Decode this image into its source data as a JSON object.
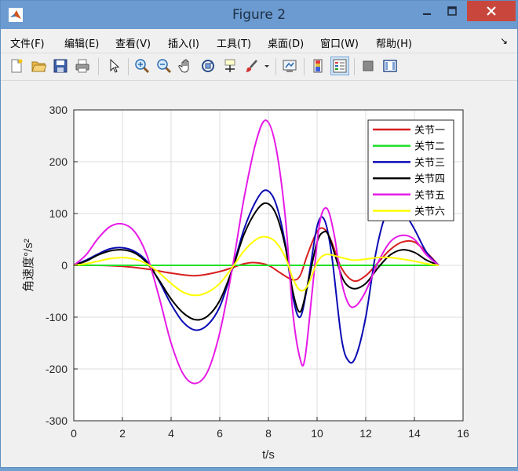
{
  "window": {
    "title": "Figure 2"
  },
  "menu": [
    {
      "label": "文件(F)"
    },
    {
      "label": "编辑(E)"
    },
    {
      "label": "查看(V)"
    },
    {
      "label": "插入(I)"
    },
    {
      "label": "工具(T)"
    },
    {
      "label": "桌面(D)"
    },
    {
      "label": "窗口(W)"
    },
    {
      "label": "帮助(H)"
    }
  ],
  "toolbar_icons": [
    "new-figure-icon",
    "open-file-icon",
    "save-icon",
    "print-icon",
    "pointer-icon",
    "zoom-in-icon",
    "zoom-out-icon",
    "pan-icon",
    "rotate-3d-icon",
    "data-cursor-icon",
    "brush-icon",
    "link-plot-icon",
    "colorbar-icon",
    "legend-icon",
    "hide-plot-tools-icon",
    "show-plot-tools-icon"
  ],
  "colors": {
    "titlebar": "#6b9bd0",
    "close": "#c9463d"
  },
  "chart_data": {
    "type": "line",
    "xlabel": "t/s",
    "ylabel": "角速度°/s²",
    "xlim": [
      0,
      16
    ],
    "ylim": [
      -300,
      300
    ],
    "xticks": [
      0,
      2,
      4,
      6,
      8,
      10,
      12,
      14,
      16
    ],
    "yticks": [
      -300,
      -200,
      -100,
      0,
      100,
      200,
      300
    ],
    "grid": true,
    "legend_position": "top-right",
    "series": [
      {
        "name": "关节一",
        "color": "#d81f1f",
        "x": [
          0,
          1,
          2,
          3,
          4,
          5,
          6,
          7,
          7.5,
          8,
          8.5,
          9,
          9.3,
          9.6,
          10,
          10.3,
          10.6,
          11,
          11.5,
          12,
          12.5,
          13,
          13.5,
          14,
          14.5,
          15
        ],
        "y": [
          0,
          0,
          -2,
          -7,
          -15,
          -20,
          -12,
          3,
          5,
          0,
          -15,
          -28,
          -20,
          20,
          65,
          70,
          45,
          -5,
          -30,
          -20,
          5,
          30,
          45,
          45,
          25,
          0
        ]
      },
      {
        "name": "关节二",
        "color": "#22e02a",
        "x": [
          0,
          1,
          2,
          3,
          4,
          5,
          6,
          7,
          8,
          9,
          10,
          11,
          12,
          13,
          14,
          15
        ],
        "y": [
          0,
          0,
          0,
          0,
          0,
          0,
          0,
          0,
          0,
          0,
          0,
          0,
          0,
          0,
          0,
          0
        ]
      },
      {
        "name": "关节三",
        "color": "#0a0ab4",
        "x": [
          0,
          0.5,
          1,
          1.5,
          2,
          2.5,
          3,
          3.5,
          4,
          4.5,
          5,
          5.5,
          6,
          6.5,
          7,
          7.5,
          7.9,
          8.3,
          8.7,
          9,
          9.3,
          9.6,
          10,
          10.3,
          10.6,
          11,
          11.3,
          11.6,
          12,
          12.4,
          12.8,
          13.2,
          13.6,
          14,
          14.5,
          15
        ],
        "y": [
          0,
          10,
          22,
          32,
          34,
          27,
          8,
          -30,
          -75,
          -110,
          -125,
          -115,
          -80,
          -10,
          70,
          125,
          145,
          120,
          40,
          -60,
          -100,
          -40,
          75,
          88,
          20,
          -140,
          -185,
          -175,
          -100,
          20,
          95,
          115,
          100,
          70,
          25,
          0
        ]
      },
      {
        "name": "关节四",
        "color": "#000000",
        "x": [
          0,
          0.5,
          1,
          1.5,
          2,
          2.5,
          3,
          3.5,
          4,
          4.5,
          5,
          5.5,
          6,
          6.5,
          7,
          7.5,
          7.9,
          8.3,
          8.7,
          9,
          9.3,
          9.6,
          10,
          10.3,
          10.5,
          10.8,
          11.1,
          11.5,
          12,
          12.5,
          13,
          13.5,
          14,
          14.5,
          15
        ],
        "y": [
          0,
          8,
          20,
          28,
          30,
          24,
          5,
          -28,
          -65,
          -92,
          -105,
          -98,
          -68,
          -10,
          60,
          105,
          120,
          100,
          35,
          -50,
          -90,
          -40,
          45,
          65,
          55,
          10,
          -30,
          -45,
          -35,
          -5,
          20,
          30,
          25,
          10,
          0
        ]
      },
      {
        "name": "关节五",
        "color": "#e61ae6",
        "x": [
          0,
          0.5,
          1,
          1.5,
          2,
          2.5,
          3,
          3.5,
          4,
          4.5,
          5,
          5.5,
          6,
          6.5,
          7,
          7.5,
          7.9,
          8.3,
          8.7,
          9,
          9.3,
          9.5,
          9.8,
          10.1,
          10.4,
          10.7,
          11,
          11.3,
          11.6,
          12,
          12.5,
          13,
          13.5,
          14,
          14.5,
          15
        ],
        "y": [
          0,
          20,
          52,
          75,
          80,
          65,
          20,
          -60,
          -150,
          -210,
          -228,
          -205,
          -130,
          -10,
          130,
          240,
          280,
          230,
          90,
          -90,
          -180,
          -180,
          -50,
          80,
          110,
          60,
          -30,
          -75,
          -78,
          -50,
          5,
          45,
          58,
          50,
          20,
          0
        ]
      },
      {
        "name": "关节六",
        "color": "#ffff00",
        "x": [
          0,
          0.5,
          1,
          1.5,
          2,
          2.5,
          3,
          3.5,
          4,
          4.5,
          5,
          5.5,
          6,
          6.5,
          7,
          7.5,
          7.9,
          8.3,
          8.7,
          9,
          9.3,
          9.6,
          10,
          10.3,
          10.6,
          11,
          11.5,
          12,
          12.5,
          13,
          13.5,
          14,
          14.5,
          15
        ],
        "y": [
          0,
          3,
          8,
          13,
          15,
          12,
          3,
          -14,
          -35,
          -52,
          -58,
          -52,
          -35,
          -5,
          28,
          50,
          55,
          45,
          15,
          -25,
          -48,
          -40,
          5,
          20,
          20,
          15,
          10,
          12,
          15,
          15,
          12,
          8,
          3,
          0
        ]
      }
    ]
  }
}
